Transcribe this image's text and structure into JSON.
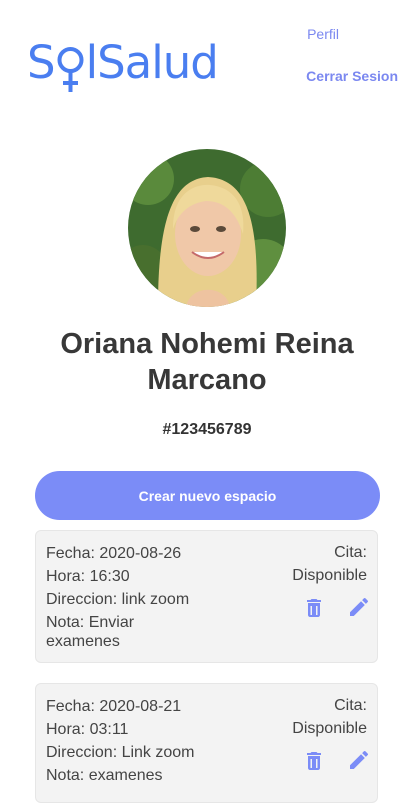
{
  "brand": {
    "logo_text_a": "S",
    "logo_text_b": "lSalud"
  },
  "nav": {
    "profile_label": "Perfil",
    "logout_label": "Cerrar Sesion"
  },
  "profile": {
    "name": "Oriana Nohemi Reina Marcano",
    "id": "#123456789"
  },
  "actions": {
    "create_label": "Crear nuevo espacio"
  },
  "appointments": [
    {
      "date": "Fecha: 2020-08-26",
      "time": "Hora: 16:30",
      "address": "Direccion: link zoom",
      "note_line1": "Nota: Enviar",
      "note_line2": "examenes",
      "status_title": "Cita:",
      "status_value": "Disponible"
    },
    {
      "date": "Fecha: 2020-08-21",
      "time": "Hora: 03:11",
      "address": "Direccion: Link zoom",
      "note_line1": "Nota: examenes",
      "note_line2": "",
      "status_title": "Cita:",
      "status_value": "Disponible"
    }
  ],
  "colors": {
    "accent": "#7b8cf7",
    "logo": "#4a7ef0",
    "card_bg": "#f3f3f3"
  },
  "icons": {
    "delete": "trash-icon",
    "edit": "pencil-icon"
  }
}
